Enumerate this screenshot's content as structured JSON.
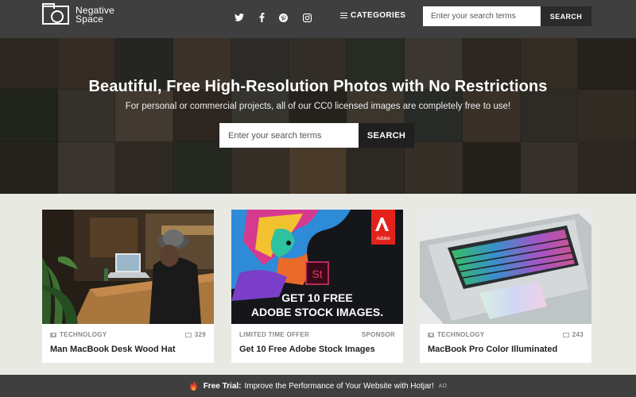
{
  "header": {
    "logo_line1": "Negative",
    "logo_line2": "Space",
    "social": [
      "twitter-icon",
      "facebook-icon",
      "pinterest-icon",
      "instagram-icon"
    ],
    "categories_label": "CATEGORIES",
    "search_placeholder": "Enter your search terms",
    "search_button": "SEARCH"
  },
  "hero": {
    "title": "Beautiful, Free High-Resolution Photos with No Restrictions",
    "subtitle": "For personal or commercial projects, all of our CC0 licensed images are completely free to use!",
    "search_placeholder": "Enter your search terms",
    "search_button": "SEARCH"
  },
  "cards": [
    {
      "category": "TECHNOLOGY",
      "count": "329",
      "title": "Man MacBook Desk Wood Hat"
    },
    {
      "category": "LIMITED TIME OFFER",
      "right_label": "SPONSOR",
      "title": "Get 10 Free Adobe Stock Images",
      "ad_badge": "Adobe",
      "ad_logo": "St",
      "ad_line1": "GET 10 FREE",
      "ad_line2": "ADOBE STOCK IMAGES."
    },
    {
      "category": "TECHNOLOGY",
      "count": "243",
      "title": "MacBook Pro Color Illuminated"
    }
  ],
  "bottom_bar": {
    "bold": "Free Trial:",
    "text": "Improve the Performance of Your Website with Hotjar!",
    "ad": "AD"
  },
  "colors": {
    "nav_bg": "#3f3f3f",
    "page_bg": "#e9e9e4",
    "adobe_red": "#e3231b",
    "adobe_stock_pink": "#3a0a1a"
  }
}
